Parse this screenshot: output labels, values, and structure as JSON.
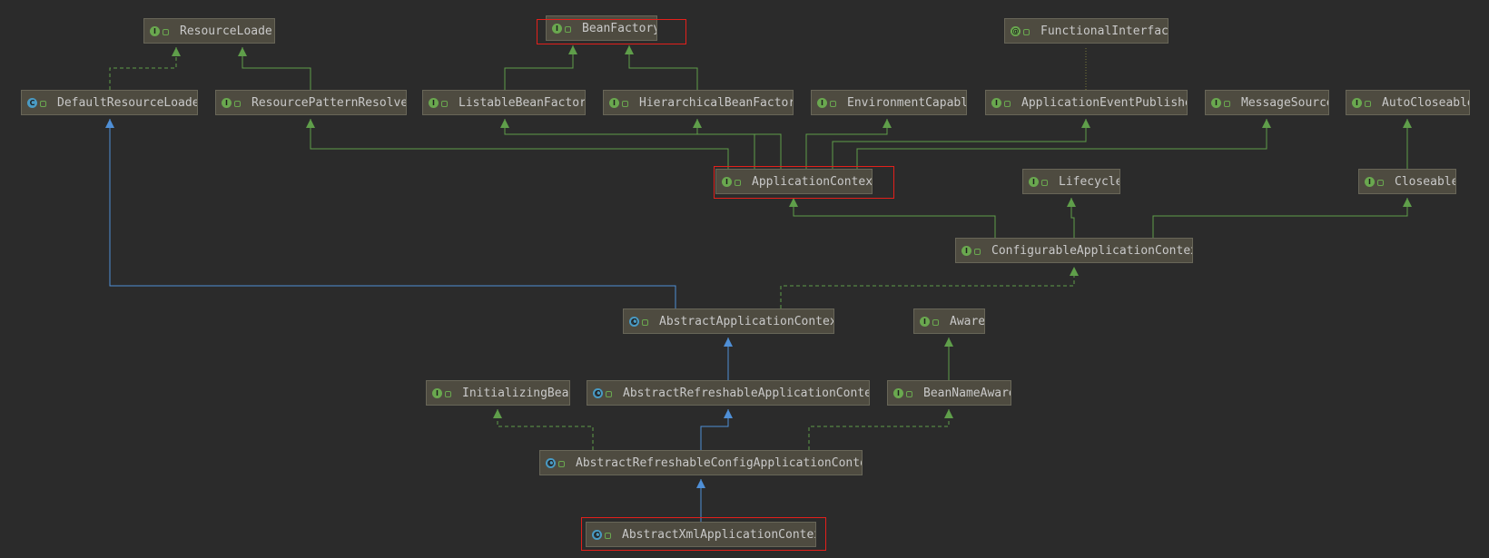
{
  "colors": {
    "background": "#2b2b2b",
    "node_fill": "#4e4b40",
    "node_border": "#686658",
    "text": "#c9c9c9",
    "implements_edge": "#5f9e4a",
    "extends_edge": "#4f8fd6",
    "highlight": "#e3201b"
  },
  "nodes": {
    "resource_loader": {
      "label": "ResourceLoader",
      "kind": "interface",
      "icon": "interface-icon"
    },
    "bean_factory": {
      "label": "BeanFactory",
      "kind": "interface",
      "icon": "interface-icon"
    },
    "functional_interface": {
      "label": "FunctionalInterface",
      "kind": "annotation",
      "icon": "annotation-icon"
    },
    "default_resource_loader": {
      "label": "DefaultResourceLoader",
      "kind": "class",
      "icon": "class-icon"
    },
    "resource_pattern_resolver": {
      "label": "ResourcePatternResolver",
      "kind": "interface",
      "icon": "interface-icon"
    },
    "listable_bean_factory": {
      "label": "ListableBeanFactory",
      "kind": "interface",
      "icon": "interface-icon"
    },
    "hierarchical_bean_factory": {
      "label": "HierarchicalBeanFactory",
      "kind": "interface",
      "icon": "interface-icon"
    },
    "environment_capable": {
      "label": "EnvironmentCapable",
      "kind": "interface",
      "icon": "interface-icon"
    },
    "application_event_publisher": {
      "label": "ApplicationEventPublisher",
      "kind": "interface",
      "icon": "interface-icon"
    },
    "message_source": {
      "label": "MessageSource",
      "kind": "interface",
      "icon": "interface-icon"
    },
    "auto_closeable": {
      "label": "AutoCloseable",
      "kind": "interface",
      "icon": "interface-icon"
    },
    "application_context": {
      "label": "ApplicationContext",
      "kind": "interface",
      "icon": "interface-icon"
    },
    "lifecycle": {
      "label": "Lifecycle",
      "kind": "interface",
      "icon": "interface-icon"
    },
    "closeable": {
      "label": "Closeable",
      "kind": "interface",
      "icon": "interface-icon"
    },
    "configurable_application_context": {
      "label": "ConfigurableApplicationContext",
      "kind": "interface",
      "icon": "interface-icon"
    },
    "abstract_application_context": {
      "label": "AbstractApplicationContext",
      "kind": "abstract",
      "icon": "abstract-class-icon"
    },
    "aware": {
      "label": "Aware",
      "kind": "interface",
      "icon": "interface-icon"
    },
    "initializing_bean": {
      "label": "InitializingBean",
      "kind": "interface",
      "icon": "interface-icon"
    },
    "abstract_refreshable_application_context": {
      "label": "AbstractRefreshableApplicationContext",
      "kind": "abstract",
      "icon": "abstract-class-icon"
    },
    "bean_name_aware": {
      "label": "BeanNameAware",
      "kind": "interface",
      "icon": "interface-icon"
    },
    "abstract_refreshable_config_application_context": {
      "label": "AbstractRefreshableConfigApplicationContext",
      "kind": "abstract",
      "icon": "abstract-class-icon"
    },
    "abstract_xml_application_context": {
      "label": "AbstractXmlApplicationContext",
      "kind": "abstract",
      "icon": "abstract-class-icon"
    }
  },
  "edges": [
    {
      "from": "default_resource_loader",
      "to": "resource_loader",
      "type": "implements"
    },
    {
      "from": "resource_pattern_resolver",
      "to": "resource_loader",
      "type": "extends_interface"
    },
    {
      "from": "listable_bean_factory",
      "to": "bean_factory",
      "type": "extends_interface"
    },
    {
      "from": "hierarchical_bean_factory",
      "to": "bean_factory",
      "type": "extends_interface"
    },
    {
      "from": "application_event_publisher",
      "to": "functional_interface",
      "type": "annotated"
    },
    {
      "from": "application_context",
      "to": "resource_pattern_resolver",
      "type": "extends_interface"
    },
    {
      "from": "application_context",
      "to": "listable_bean_factory",
      "type": "extends_interface"
    },
    {
      "from": "application_context",
      "to": "hierarchical_bean_factory",
      "type": "extends_interface"
    },
    {
      "from": "application_context",
      "to": "environment_capable",
      "type": "extends_interface"
    },
    {
      "from": "application_context",
      "to": "application_event_publisher",
      "type": "extends_interface"
    },
    {
      "from": "application_context",
      "to": "message_source",
      "type": "extends_interface"
    },
    {
      "from": "closeable",
      "to": "auto_closeable",
      "type": "extends_interface"
    },
    {
      "from": "configurable_application_context",
      "to": "application_context",
      "type": "extends_interface"
    },
    {
      "from": "configurable_application_context",
      "to": "lifecycle",
      "type": "extends_interface"
    },
    {
      "from": "configurable_application_context",
      "to": "closeable",
      "type": "extends_interface"
    },
    {
      "from": "abstract_application_context",
      "to": "default_resource_loader",
      "type": "extends"
    },
    {
      "from": "abstract_application_context",
      "to": "configurable_application_context",
      "type": "implements"
    },
    {
      "from": "bean_name_aware",
      "to": "aware",
      "type": "extends_interface"
    },
    {
      "from": "abstract_refreshable_application_context",
      "to": "abstract_application_context",
      "type": "extends"
    },
    {
      "from": "abstract_refreshable_config_application_context",
      "to": "abstract_refreshable_application_context",
      "type": "extends"
    },
    {
      "from": "abstract_refreshable_config_application_context",
      "to": "initializing_bean",
      "type": "implements"
    },
    {
      "from": "abstract_refreshable_config_application_context",
      "to": "bean_name_aware",
      "type": "implements"
    },
    {
      "from": "abstract_xml_application_context",
      "to": "abstract_refreshable_config_application_context",
      "type": "extends"
    }
  ],
  "highlighted": [
    "bean_factory",
    "application_context",
    "abstract_xml_application_context"
  ]
}
